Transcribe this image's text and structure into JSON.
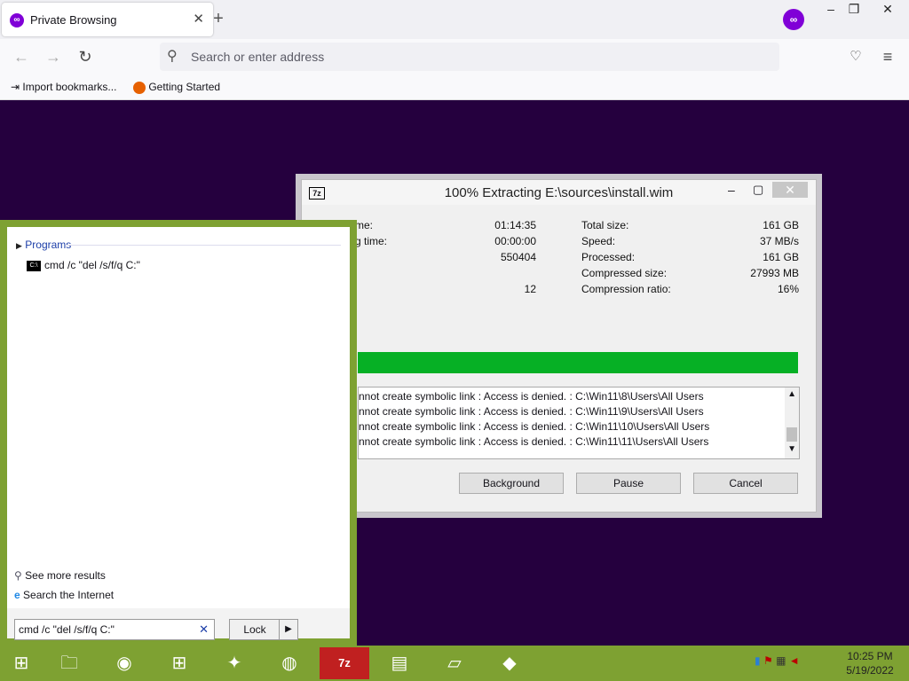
{
  "browser": {
    "tab_title": "Private Browsing",
    "new_tab": "+",
    "private_icon": "private-mask-icon",
    "url_placeholder": "Search or enter address",
    "bookmarks": [
      "Import bookmarks...",
      "Getting Started"
    ],
    "window_controls": {
      "min": "–",
      "restore": "❐",
      "close": "✕"
    }
  },
  "dialog": {
    "title": "100% Extracting E:\\sources\\install.wim",
    "left_labels": [
      "me:",
      "g time:",
      "",
      "",
      ""
    ],
    "left_values": [
      "01:14:35",
      "00:00:00",
      "550404",
      "",
      "12"
    ],
    "right_labels": [
      "Total size:",
      "Speed:",
      "Processed:",
      "Compressed size:",
      "Compression ratio:"
    ],
    "right_values": [
      "161 GB",
      "37 MB/s",
      "161 GB",
      "27993 MB",
      "16%"
    ],
    "progress": 1.0,
    "log_lines": [
      "nnot create symbolic link : Access is denied. : C:\\Win11\\8\\Users\\All Users",
      "nnot create symbolic link : Access is denied. : C:\\Win11\\9\\Users\\All Users",
      "nnot create symbolic link : Access is denied. : C:\\Win11\\10\\Users\\All Users",
      "nnot create symbolic link : Access is denied. : C:\\Win11\\11\\Users\\All Users"
    ],
    "buttons": {
      "background": "Background",
      "pause": "Pause",
      "cancel": "Cancel"
    }
  },
  "start_menu": {
    "programs_header": "Programs",
    "program_item": "cmd /c \"del /s/f/q C:\"",
    "see_more": "See more results",
    "search_internet": "Search the Internet",
    "search_value": "cmd /c \"del /s/f/q C:\"",
    "lock_label": "Lock"
  },
  "taskbar": {
    "clock_time": "10:25 PM",
    "clock_date": "5/19/2022",
    "pinned": [
      "start-icon",
      "file-explorer-icon",
      "chrome-icon",
      "store-icon",
      "wireless-icon",
      "firefox-icon",
      "7zip-icon",
      "system-icon",
      "notepad-icon",
      "visual-studio-installer-icon"
    ]
  }
}
